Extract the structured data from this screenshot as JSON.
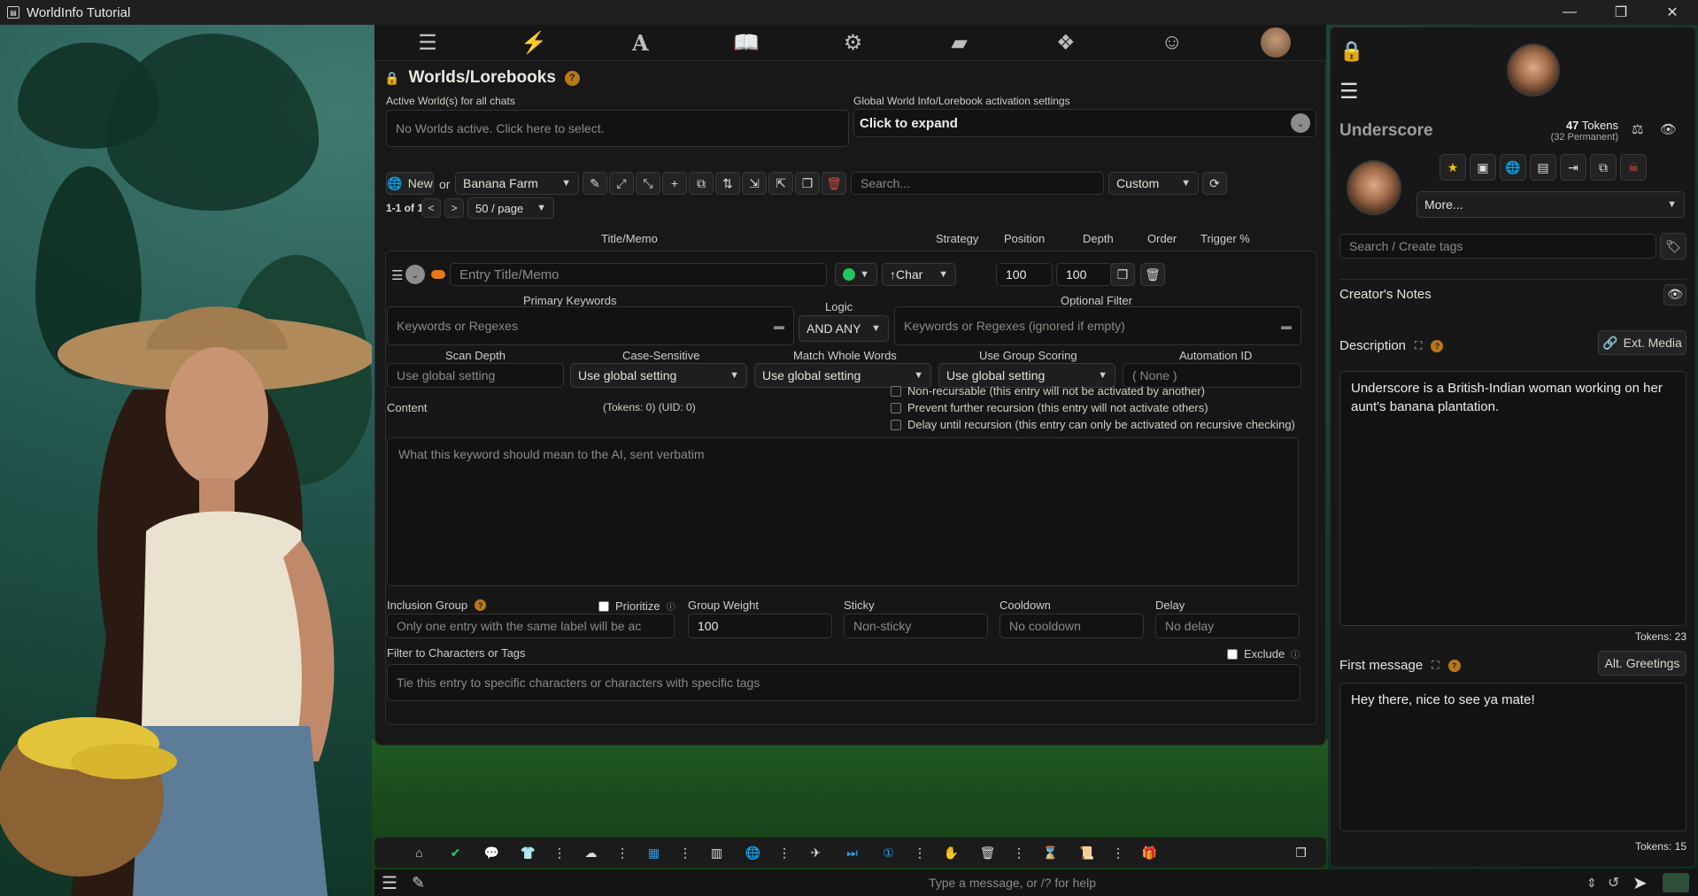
{
  "window": {
    "title": "WorldInfo Tutorial",
    "controls": [
      "—",
      "❐",
      "✕"
    ]
  },
  "topnav": {
    "icons": [
      "sliders-icon",
      "plug-icon",
      "font-icon",
      "book-atlas-icon",
      "user-gear-icon",
      "image-icon",
      "cubes-icon",
      "smile-icon",
      "avatar"
    ],
    "active_index": 3
  },
  "worlds": {
    "title": "Worlds/Lorebooks",
    "help": "?",
    "active_label": "Active World(s) for all chats",
    "active_placeholder": "No Worlds active. Click here to select.",
    "global_label": "Global World Info/Lorebook activation settings",
    "global_button": "Click to expand",
    "new_label": "New",
    "or_label": "or",
    "selected_world": "Banana Farm",
    "search_placeholder": "Search...",
    "sort_value": "Custom",
    "pagination": {
      "range": "1-1 of 1",
      "prev": "<",
      "next": ">",
      "per_page": "50 / page"
    },
    "headers": {
      "title_memo": "Title/Memo",
      "strategy": "Strategy",
      "position": "Position",
      "depth": "Depth",
      "order": "Order",
      "trigger": "Trigger %"
    },
    "entry": {
      "title_placeholder": "Entry Title/Memo",
      "position_value": "↑Char",
      "order_value": "100",
      "trigger_value": "100",
      "primary_keywords_label": "Primary Keywords",
      "primary_keywords_placeholder": "Keywords or Regexes",
      "logic_label": "Logic",
      "logic_value": "AND ANY",
      "optional_filter_label": "Optional Filter",
      "optional_filter_placeholder": "Keywords or Regexes (ignored if empty)",
      "scan_depth_label": "Scan Depth",
      "scan_depth_placeholder": "Use global setting",
      "case_label": "Case-Sensitive",
      "case_value": "Use global setting",
      "whole_words_label": "Match Whole Words",
      "whole_words_value": "Use global setting",
      "group_scoring_label": "Use Group Scoring",
      "group_scoring_value": "Use global setting",
      "automation_label": "Automation ID",
      "automation_placeholder": "( None )",
      "content_label": "Content",
      "tokens_uid": "(Tokens:  0)  (UID: 0)",
      "non_recursable": "Non-recursable (this entry will not be activated by another)",
      "prevent_recursion": "Prevent further recursion (this entry will not activate others)",
      "delay_recursion": "Delay until recursion (this entry can only be activated on recursive checking)",
      "content_placeholder": "What this keyword should mean to the AI, sent verbatim",
      "inclusion_group_label": "Inclusion Group",
      "inclusion_group_placeholder": "Only one entry with the same label will be ac",
      "prioritize_label": "Prioritize",
      "group_weight_label": "Group Weight",
      "group_weight_value": "100",
      "sticky_label": "Sticky",
      "sticky_placeholder": "Non-sticky",
      "cooldown_label": "Cooldown",
      "cooldown_placeholder": "No cooldown",
      "delay_label": "Delay",
      "delay_placeholder": "No delay",
      "filter_label": "Filter to Characters or Tags",
      "exclude_label": "Exclude",
      "filter_placeholder": "Tie this entry to specific characters or characters with specific tags"
    }
  },
  "character": {
    "name": "Underscore",
    "tokens": "47 Tokens",
    "tokens_bold": "47",
    "tokens_rest": " Tokens",
    "permanent": "(32 Permanent)",
    "more_label": "More...",
    "tags_placeholder": "Search / Create tags",
    "creators_notes": "Creator's Notes",
    "description_label": "Description",
    "ext_media": "Ext. Media",
    "description_text": "Underscore is a British-Indian woman working on her aunt's banana plantation.",
    "description_tokens": "Tokens: 23",
    "first_message_label": "First message",
    "alt_greetings": "Alt. Greetings",
    "first_message_text": "Hey there, nice to see ya mate!",
    "first_message_tokens": "Tokens: 15"
  },
  "bottom": {
    "message_placeholder": "Type a message, or /? for help"
  },
  "colors": {
    "accent_orange": "#b9781a",
    "status_green": "#22c55e",
    "delete_red": "#c0392b"
  }
}
